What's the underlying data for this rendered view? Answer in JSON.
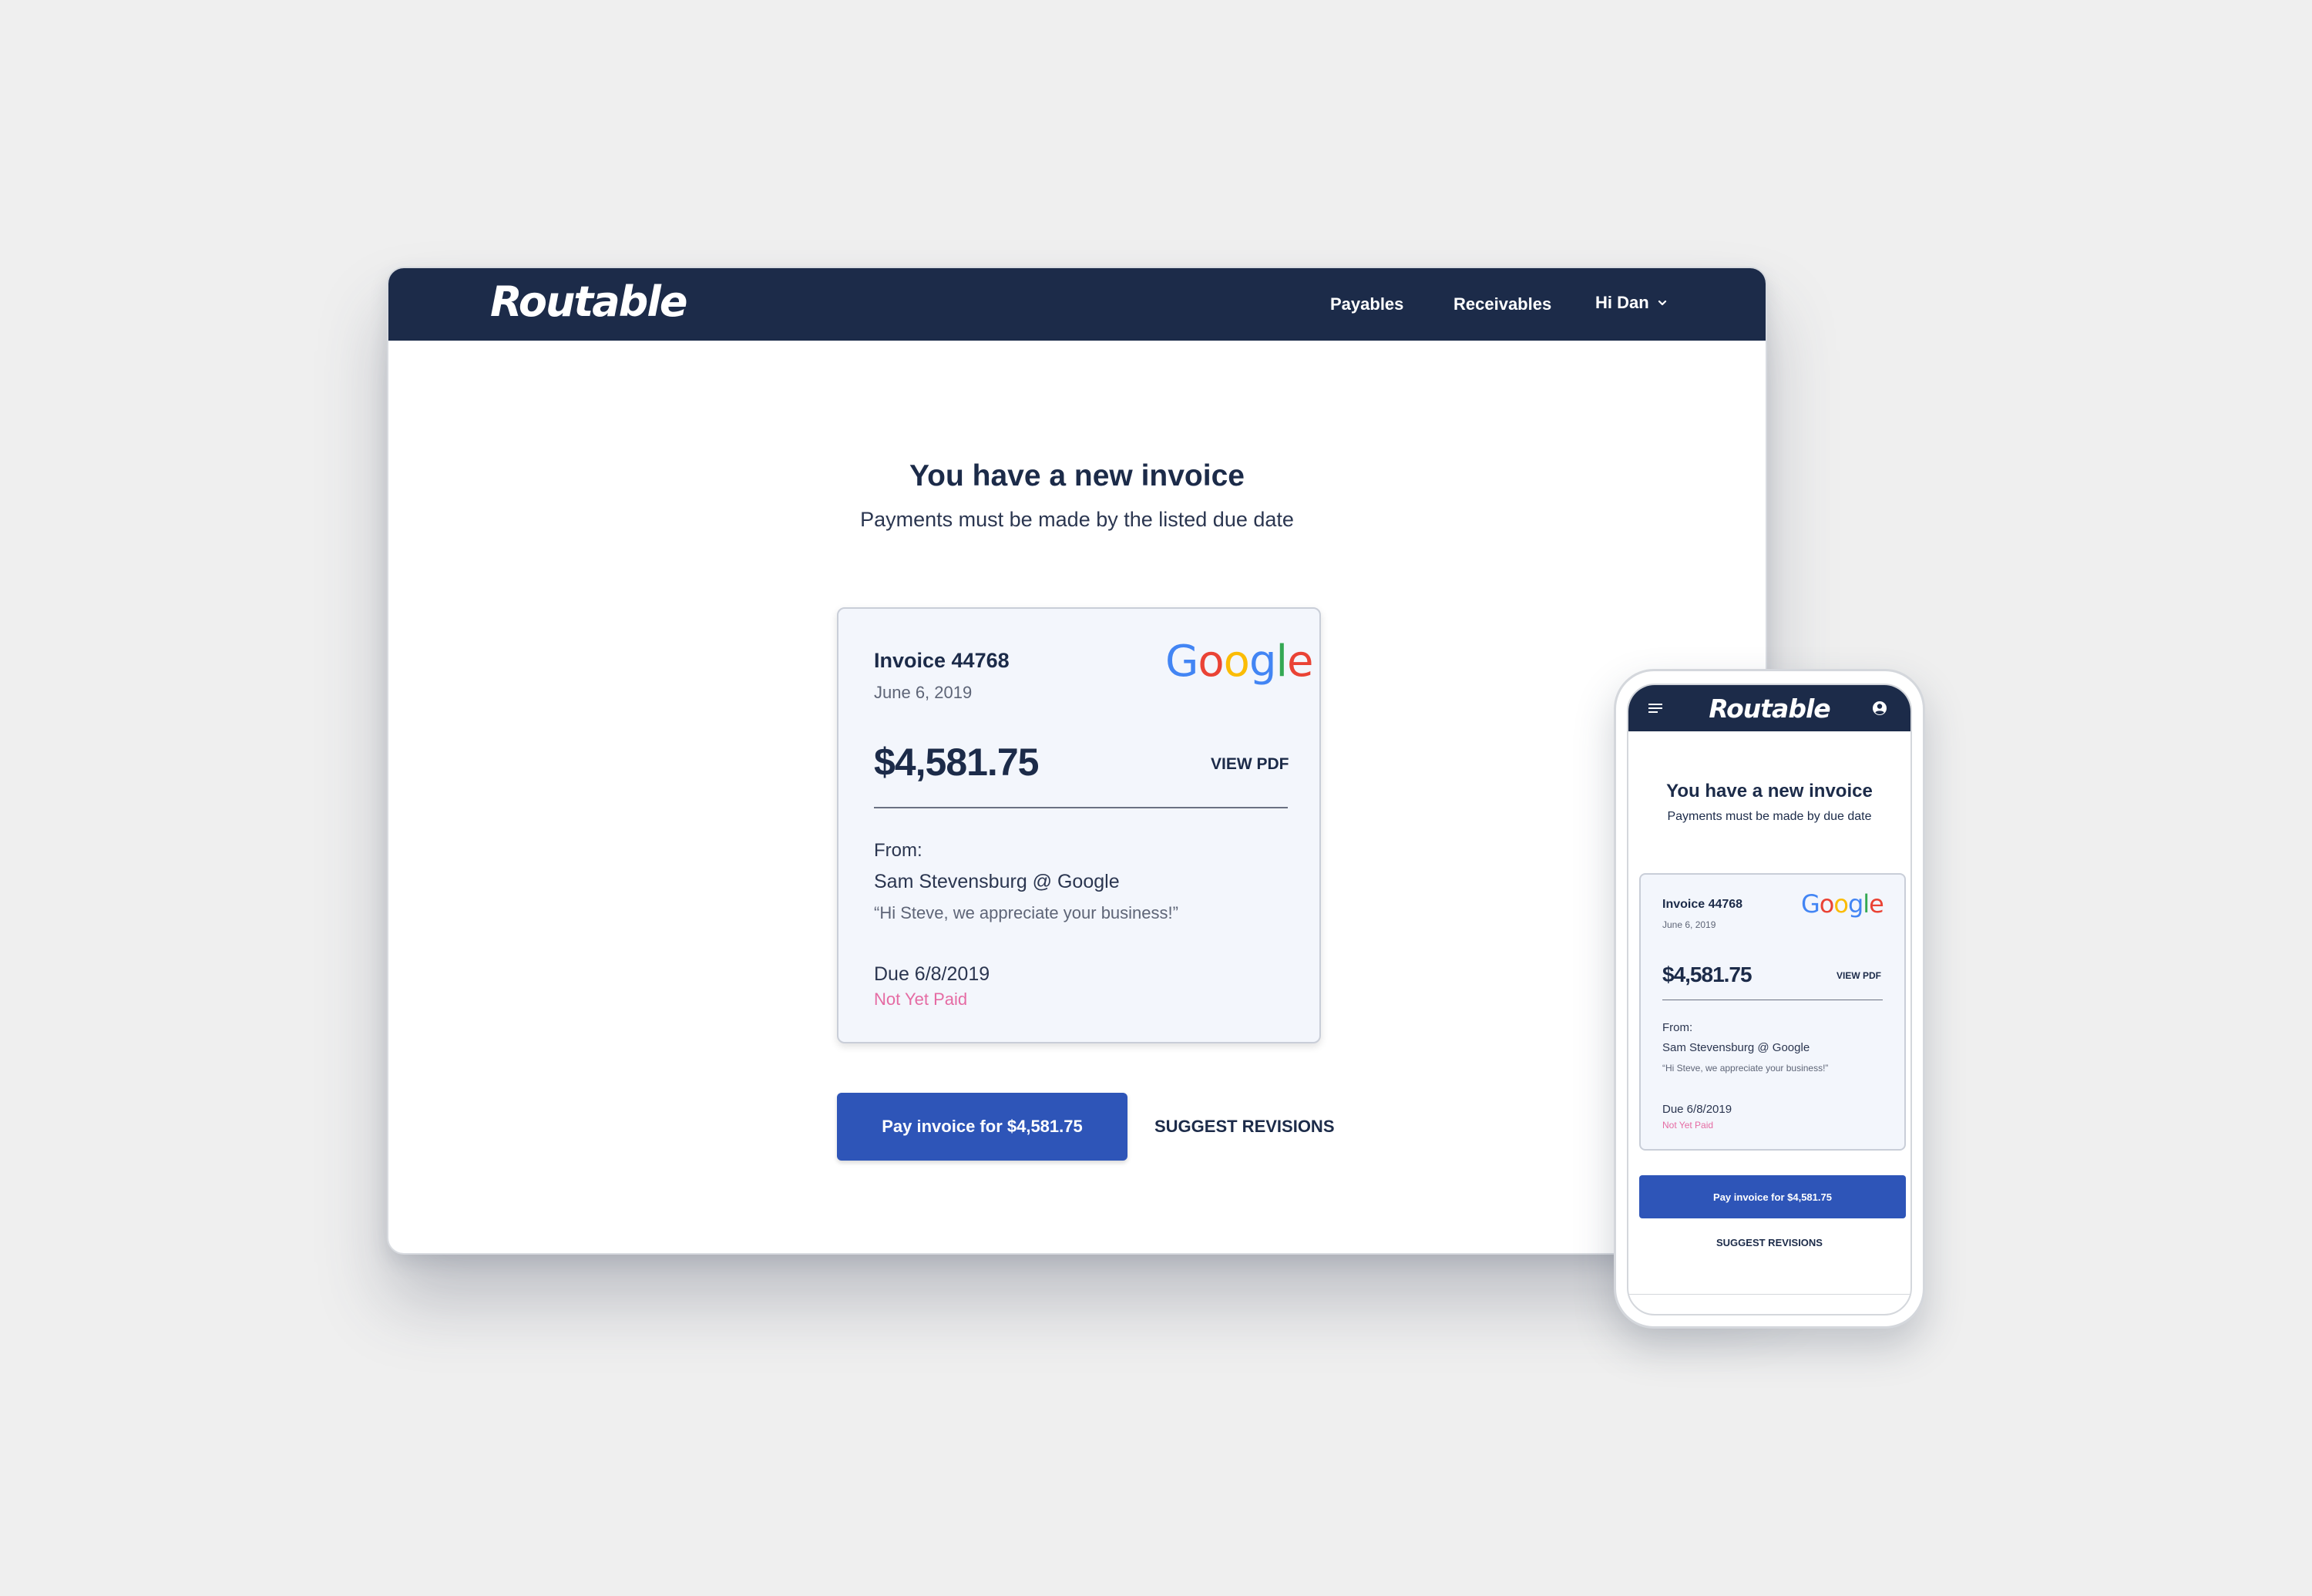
{
  "brand": {
    "name": "Routable",
    "nav_color": "#1c2b49",
    "accent": "#2e55b8",
    "status_color": "#e56ba3"
  },
  "desktop": {
    "nav": {
      "payables": "Payables",
      "receivables": "Receivables",
      "user_menu": "Hi Dan",
      "user_menu_icon": "chevron-down-icon"
    },
    "title": "You have a new invoice",
    "subtitle": "Payments must be made by the listed due date",
    "invoice": {
      "number": "Invoice 44768",
      "date": "June 6, 2019",
      "company_logo_text": "Google",
      "amount": "$4,581.75",
      "view_pdf": "VIEW PDF",
      "from_label": "From:",
      "from_name": "Sam Stevensburg @ Google",
      "note": "“Hi Steve, we appreciate your business!”",
      "due": "Due 6/8/2019",
      "status": "Not Yet Paid"
    },
    "pay_button": "Pay invoice for $4,581.75",
    "suggest_button": "SUGGEST REVISIONS"
  },
  "mobile": {
    "nav": {
      "menu_icon": "hamburger-icon",
      "user_icon": "user-circle-icon"
    },
    "title": "You have a new invoice",
    "subtitle": "Payments must be made by due date",
    "invoice": {
      "number": "Invoice 44768",
      "date": "June 6, 2019",
      "company_logo_text": "Google",
      "amount": "$4,581.75",
      "view_pdf": "VIEW PDF",
      "from_label": "From:",
      "from_name": "Sam Stevensburg @ Google",
      "note": "“Hi Steve, we appreciate your business!”",
      "due": "Due 6/8/2019",
      "status": "Not Yet Paid"
    },
    "pay_button": "Pay invoice for $4,581.75",
    "suggest_button": "SUGGEST REVISIONS"
  }
}
